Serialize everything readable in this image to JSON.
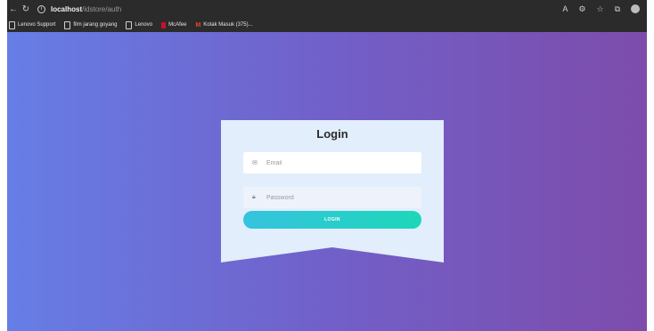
{
  "browser": {
    "url_host": "localhost",
    "url_path": "/idstore/auth",
    "bookmarks": [
      {
        "label": "Lenovo Support",
        "icon": "page-icon"
      },
      {
        "label": "film jarang goyang",
        "icon": "page-icon"
      },
      {
        "label": "Lenovo",
        "icon": "page-icon"
      },
      {
        "label": "McAfee",
        "icon": "mcafee-icon"
      },
      {
        "label": "Kotak Masuk (375)...",
        "icon": "gmail-icon"
      }
    ]
  },
  "login": {
    "title": "Login",
    "email_placeholder": "Email",
    "password_placeholder": "Password",
    "button_label": "LOGIN"
  },
  "colors": {
    "bg_start": "#667ee6",
    "bg_end": "#7d4cab",
    "card": "#e2eefb",
    "button_start": "#35c3df",
    "button_end": "#1ed7b9"
  }
}
